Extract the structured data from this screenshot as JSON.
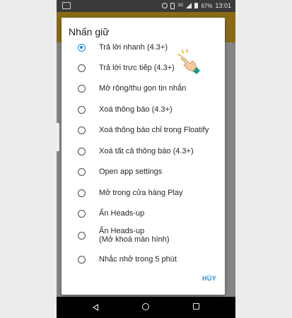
{
  "status_bar": {
    "network": "3G",
    "battery": "67%",
    "time": "13:01"
  },
  "dialog": {
    "title": "Nhấn giữ",
    "options": [
      {
        "label": "Trả lời nhanh (4.3+)",
        "selected": true
      },
      {
        "label": "Trả lời trực tiếp (4.3+)",
        "selected": false
      },
      {
        "label": "Mở rộng/thu gọn tin nhắn",
        "selected": false
      },
      {
        "label": "Xoá thông báo (4.3+)",
        "selected": false
      },
      {
        "label": "Xoá thông báo chỉ trong Floatify",
        "selected": false
      },
      {
        "label": "Xoá tất cả thông báo (4.3+)",
        "selected": false
      },
      {
        "label": "Open app settings",
        "selected": false
      },
      {
        "label": "Mở trong cửa hàng Play",
        "selected": false
      },
      {
        "label": "Ẩn Heads-up",
        "selected": false
      },
      {
        "label": "Ẩn Heads-up\n(Mở khoá màn hình)",
        "selected": false
      },
      {
        "label": "Nhắc nhở trong 5 phút",
        "selected": false
      }
    ],
    "cancel_label": "HỦY"
  },
  "colors": {
    "accent": "#1e88e5",
    "app_bar": "#8a6a15",
    "pointer_hand": "#f4c9a0",
    "pointer_cuff": "#1a9a8a"
  },
  "icons": [
    "gallery-icon",
    "alarm-icon",
    "vibrate-icon",
    "signal-icon",
    "battery-icon",
    "back-icon",
    "home-icon",
    "recent-apps-icon",
    "tap-hand-icon"
  ]
}
